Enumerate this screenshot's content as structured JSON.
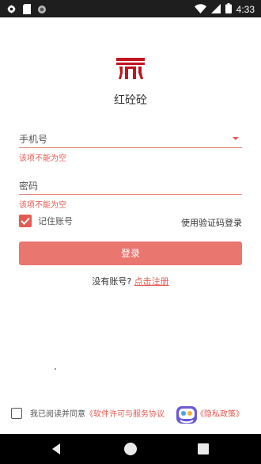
{
  "status_bar": {
    "time": "4:33",
    "icons": [
      "gear-icon",
      "sim-icon",
      "circle-icon",
      "wifi-icon",
      "signal-icon",
      "battery-icon"
    ]
  },
  "app": {
    "name": "红砼砼",
    "brand_color": "#c0161f",
    "accent_color": "#e35b52"
  },
  "form": {
    "phone_label": "手机号",
    "phone_error": "该项不能为空",
    "password_label": "密码",
    "password_error": "该项不能为空",
    "remember_label": "记住账号",
    "remember_checked": true,
    "sms_login": "使用验证码登录",
    "login_button": "登录"
  },
  "register": {
    "prompt": "没有账号?",
    "link": "点击注册"
  },
  "agreement": {
    "checked": false,
    "text": "我已阅读并同意",
    "link1": "《软件许可与服务协议",
    "link2": "《隐私政策》"
  },
  "nav_bar": {
    "icons": [
      "back-icon",
      "home-icon",
      "recents-icon"
    ]
  }
}
